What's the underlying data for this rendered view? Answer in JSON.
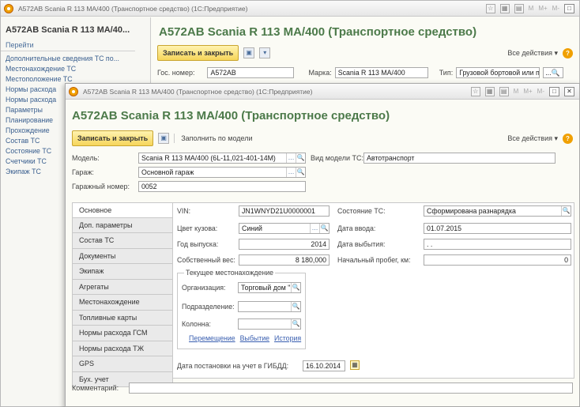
{
  "back_window": {
    "title": "А572АВ Scania R 113 МА/400 (Транспортное средство) (1С:Предприятие)",
    "memory_buttons": [
      "M",
      "M+",
      "M-"
    ],
    "side_panel": {
      "heading": "А572АВ Scania R 113 МА/40...",
      "goto": "Перейти",
      "items": [
        "Дополнительные сведения ТС по...",
        "Местонахождение ТС",
        "Местоположение ТС",
        "Нормы расхода",
        "Нормы расхода",
        "Параметры",
        "Планирование",
        "Прохождение",
        "Состав ТС",
        "Состояние ТС",
        "Счетчики ТС",
        "Экипаж ТС"
      ]
    },
    "form_title": "А572АВ Scania R 113 МА/400 (Транспортное средство)",
    "save_close": "Записать и закрыть",
    "all_actions": "Все действия ▾",
    "gos_nomer_label": "Гос. номер:",
    "gos_nomer_value": "А572АВ",
    "marka_label": "Марка:",
    "marka_value": "Scania R 113 МА/400",
    "tip_label": "Тип:",
    "tip_value": "Грузовой бортовой или пикап"
  },
  "front_window": {
    "title": "А572АВ Scania R 113 МА/400 (Транспортное средство) (1С:Предприятие)",
    "memory_buttons": [
      "M",
      "M+",
      "M-"
    ],
    "form_title": "А572АВ Scania R 113 МА/400 (Транспортное средство)",
    "save_close": "Записать и закрыть",
    "fill_by_model": "Заполнить по модели",
    "all_actions": "Все действия ▾",
    "model_label": "Модель:",
    "model_value": "Scania R 113 МА/400 (6L-11,021-401-14M)",
    "model_type_label": "Вид модели ТС:",
    "model_type_value": "Автотранспорт",
    "garage_label": "Гараж:",
    "garage_value": "Основной гараж",
    "garage_num_label": "Гаражный номер:",
    "garage_num_value": "0052",
    "tabs": [
      {
        "label": "Основное",
        "active": true
      },
      {
        "label": "Доп. параметры",
        "active": false
      },
      {
        "label": "Состав ТС",
        "active": false
      },
      {
        "label": "Документы",
        "active": false
      },
      {
        "label": "Экипаж",
        "active": false
      },
      {
        "label": "Агрегаты",
        "active": false
      },
      {
        "label": "Местонахождение",
        "active": false
      },
      {
        "label": "Топливные карты",
        "active": false
      },
      {
        "label": "Нормы расхода ГСМ",
        "active": false
      },
      {
        "label": "Нормы расхода ТЖ",
        "active": false
      },
      {
        "label": "GPS",
        "active": false
      },
      {
        "label": "Бух. учет",
        "active": false
      }
    ],
    "main": {
      "vin_label": "VIN:",
      "vin_value": "JN1WNYD21U0000001",
      "color_label": "Цвет кузова:",
      "color_value": "Синий",
      "year_label": "Год выпуска:",
      "year_value": "2014",
      "weight_label": "Собственный вес:",
      "weight_value": "8 180,000",
      "state_label": "Состояние ТС:",
      "state_value": "Сформирована разнарядка",
      "date_in_label": "Дата ввода:",
      "date_in_value": "01.07.2015",
      "date_out_label": "Дата выбытия:",
      "date_out_value": " . .",
      "mileage_label": "Начальный пробег, км:",
      "mileage_value": "0",
      "location_group": "Текущее местонахождение",
      "org_label": "Организация:",
      "org_value": "Торговый дом \"Комг",
      "division_label": "Подразделение:",
      "division_value": "",
      "column_label": "Колонна:",
      "column_value": "",
      "link_move": "Перемещение",
      "link_dispose": "Выбытие",
      "link_history": "История",
      "gibdd_label": "Дата постановки на учет в ГИБДД:",
      "gibdd_value": "16.10.2014"
    },
    "comment_label": "Комментарий:",
    "comment_value": ""
  }
}
